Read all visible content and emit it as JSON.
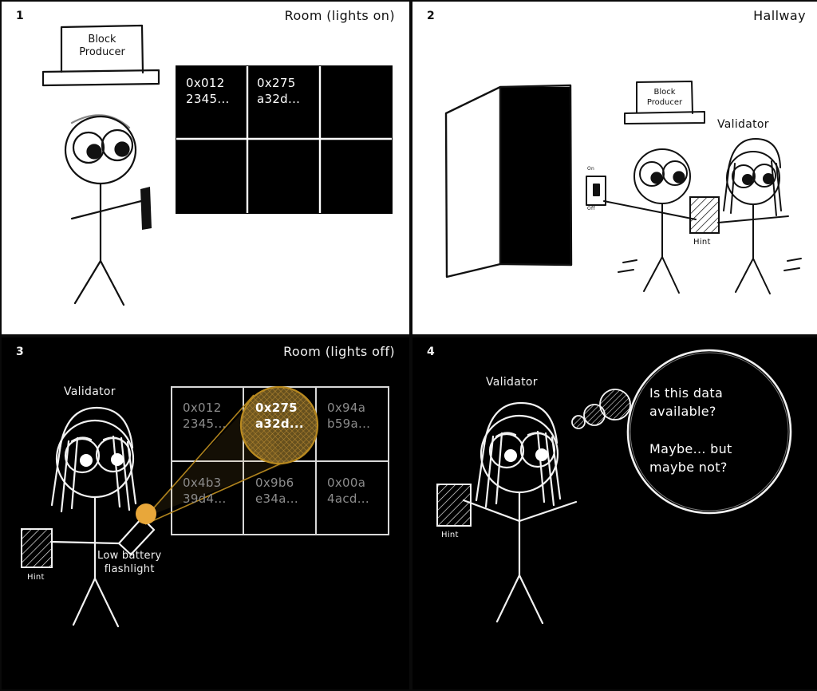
{
  "meta": {
    "bg_page": "#000000",
    "panel_light_bg": "#ffffff",
    "panel_dark_bg": "#000000",
    "ink_dark": "#111111",
    "ink_light": "#f2f2f2",
    "dim_text": "#8c8c8c",
    "accent_amber": "#e8a73a",
    "lit_cell": "#8a6e2a"
  },
  "panels": [
    {
      "number": "1",
      "title": "Room (lights on)",
      "theme": "light",
      "character": {
        "name": "Block Producer",
        "hat_label": "Block\nProducer"
      },
      "grid": {
        "columns": 3,
        "rows": 2,
        "cells": [
          "0x012\n2345...",
          "0x275\na32d...",
          "",
          "",
          "",
          ""
        ]
      }
    },
    {
      "number": "2",
      "title": "Hallway",
      "theme": "light",
      "door": "open-door",
      "switch": {
        "on_label": "On",
        "off_label": "Off"
      },
      "hint_label": "Hint",
      "characters": [
        {
          "name": "Block Producer",
          "hat_label": "Block\nProducer"
        },
        {
          "name": "Validator",
          "label": "Validator"
        }
      ]
    },
    {
      "number": "3",
      "title": "Room (lights off)",
      "theme": "dark",
      "character_label": "Validator",
      "hint_label": "Hint",
      "flashlight_label": "Low battery\nflashlight",
      "grid": {
        "columns": 3,
        "rows": 2,
        "cells": [
          "0x012\n2345...",
          "0x275\na32d...",
          "0x94a\nb59a...",
          "0x4b3\n39d4...",
          "0x9b6\ne34a...",
          "0x00a\n4acd..."
        ],
        "lit_cell_index": 1
      }
    },
    {
      "number": "4",
      "title": "",
      "theme": "dark",
      "character_label": "Validator",
      "hint_label": "Hint",
      "thought": "Is this data\navailable?\n\nMaybe... but\nmaybe not?"
    }
  ]
}
